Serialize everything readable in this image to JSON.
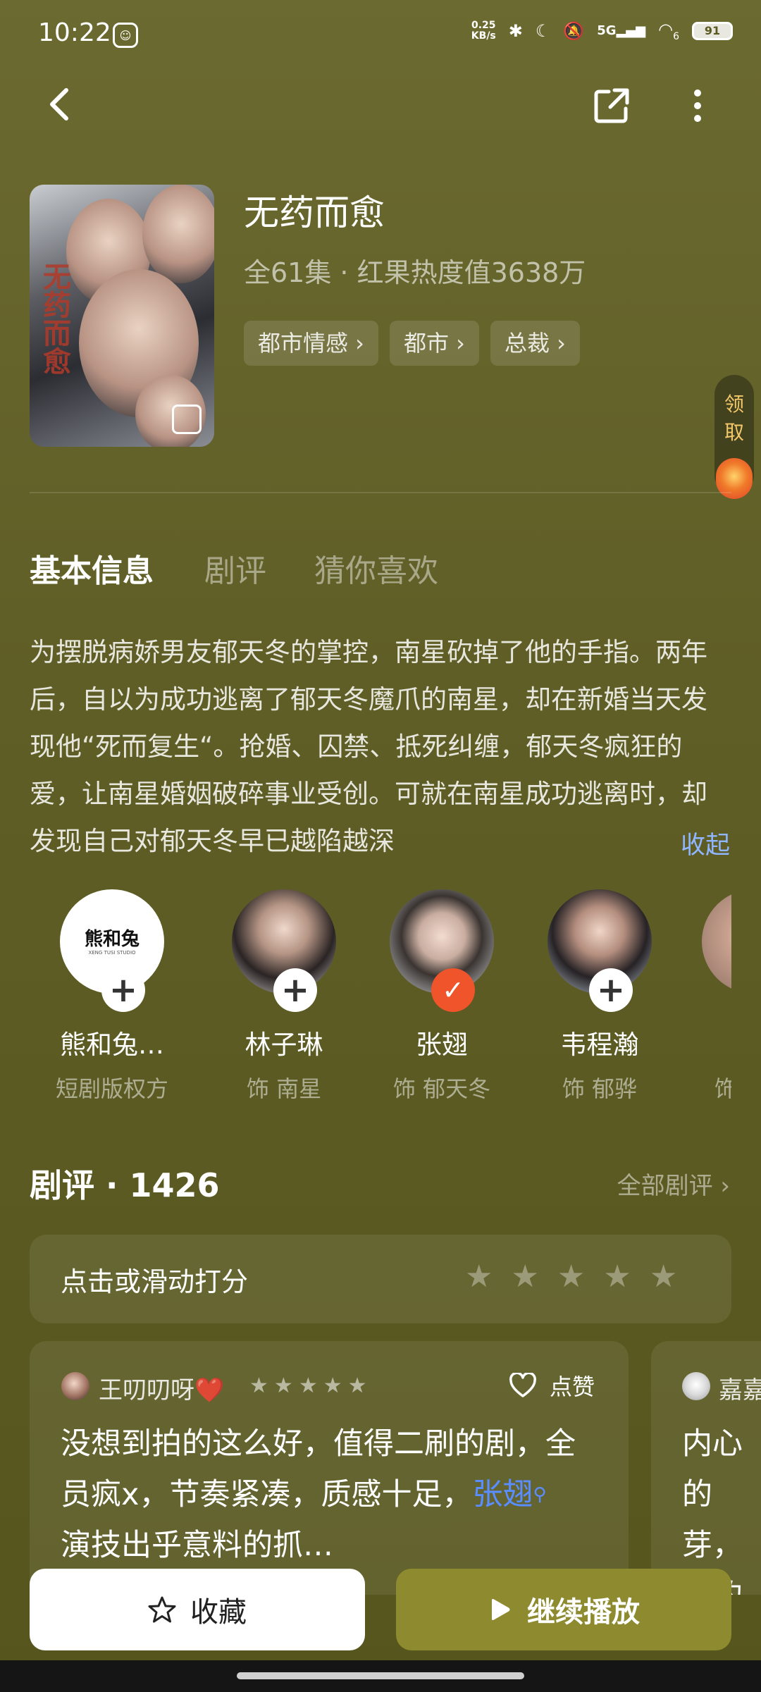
{
  "status": {
    "time": "10:22",
    "net_speed_value": "0.25",
    "net_speed_unit": "KB/s",
    "signal_label": "5G",
    "wifi_badge": "6",
    "battery": "91"
  },
  "show": {
    "title": "无药而愈",
    "subtitle": "全61集 · 红果热度值3638万",
    "tags": [
      "都市情感 ›",
      "都市 ›",
      "总裁 ›"
    ],
    "poster_title": "无药而愈"
  },
  "reward": {
    "label": "领取"
  },
  "tabs": [
    "基本信息",
    "剧评",
    "猜你喜欢"
  ],
  "description": "为摆脱病娇男友郁天冬的掌控，南星砍掉了他的手指。两年后，自以为成功逃离了郁天冬魔爪的南星，却在新婚当天发现他“死而复生“。抢婚、囚禁、抵死纠缠，郁天冬疯狂的爱，让南星婚姻破碎事业受创。可就在南星成功逃离时，却发现自己对郁天冬早已越陷越深",
  "collapse_label": "收起",
  "cast": [
    {
      "name": "熊和兔…",
      "role": "短剧版权方",
      "logo_text": "熊和兔",
      "logo_sub": "XENG TUSI STUDIO",
      "action": "+"
    },
    {
      "name": "林子琳",
      "role": "饰 南星",
      "action": "+"
    },
    {
      "name": "张翅",
      "role": "饰 郁天冬",
      "action": "✓"
    },
    {
      "name": "韦程瀚",
      "role": "饰 郁骅",
      "action": "+"
    },
    {
      "name": "",
      "role": "饰"
    }
  ],
  "reviews": {
    "title": "剧评 · 1426",
    "all_label": "全部剧评 ›",
    "rate_prompt": "点击或滑动打分",
    "rating_stars": 5,
    "cards": [
      {
        "user": "王叨叨呀❤️",
        "stars": 5,
        "like_label": "点赞",
        "text_before": "没想到拍的这么好，值得二刷的剧，全员疯x，节奏紧凑，质感十足，",
        "tag": "张翅",
        "text_after": "演技出乎意料的抓…"
      },
      {
        "user": "嘉嘉",
        "text": "内心的芽，到的时代"
      }
    ]
  },
  "actions": {
    "favorite": "收藏",
    "continue": "继续播放"
  },
  "colors": {
    "accent": "#8d8a2f",
    "follow_active": "#f0542a",
    "link": "#5a8dff",
    "background": "#625f27"
  }
}
